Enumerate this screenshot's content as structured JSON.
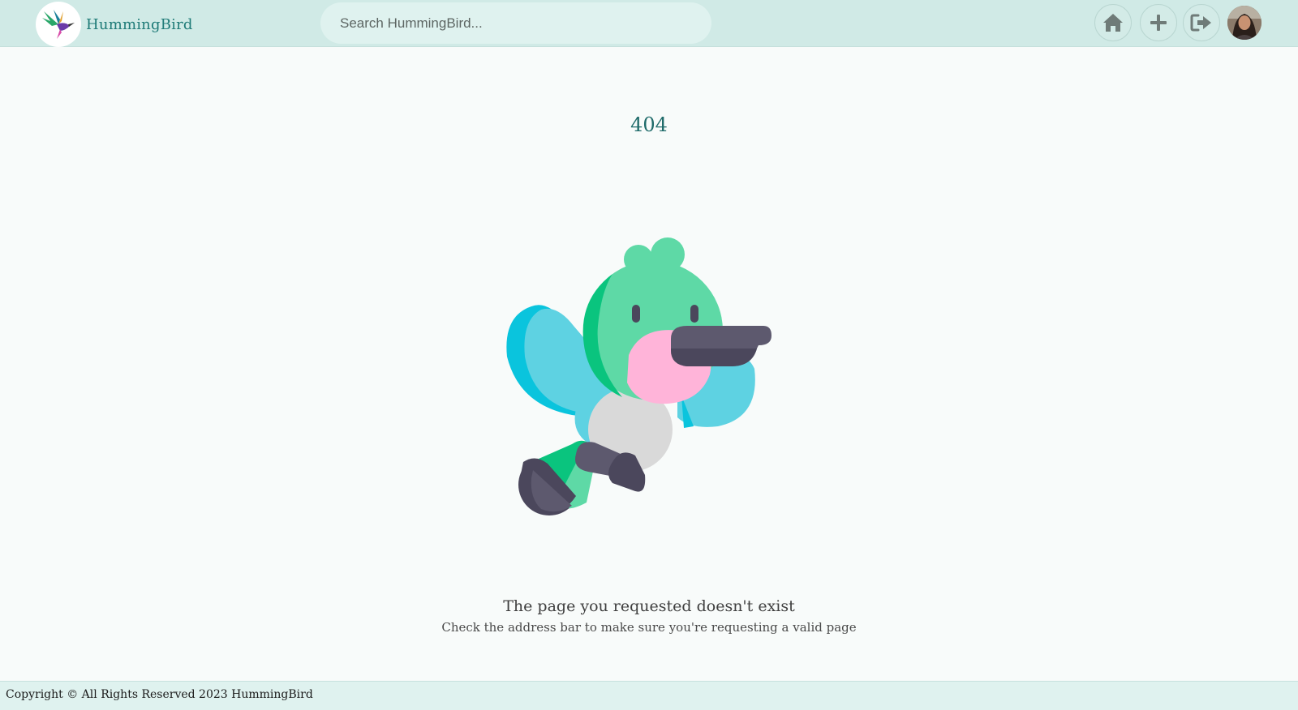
{
  "header": {
    "brand": "HummingBird",
    "search_placeholder": "Search HummingBird...",
    "buttons": [
      {
        "icon": "home-icon"
      },
      {
        "icon": "plus-icon"
      },
      {
        "icon": "logout-icon"
      }
    ]
  },
  "main": {
    "error_code": "404",
    "message": "The page you requested doesn't exist",
    "hint": "Check the address bar to make sure you're requesting a valid page"
  },
  "footer": {
    "copyright": "Copyright © All Rights Reserved 2023 HummingBird"
  },
  "colors": {
    "navbar": "#d0eae6",
    "accent": "#1f7b78",
    "page_bg": "#f8fbfa"
  }
}
